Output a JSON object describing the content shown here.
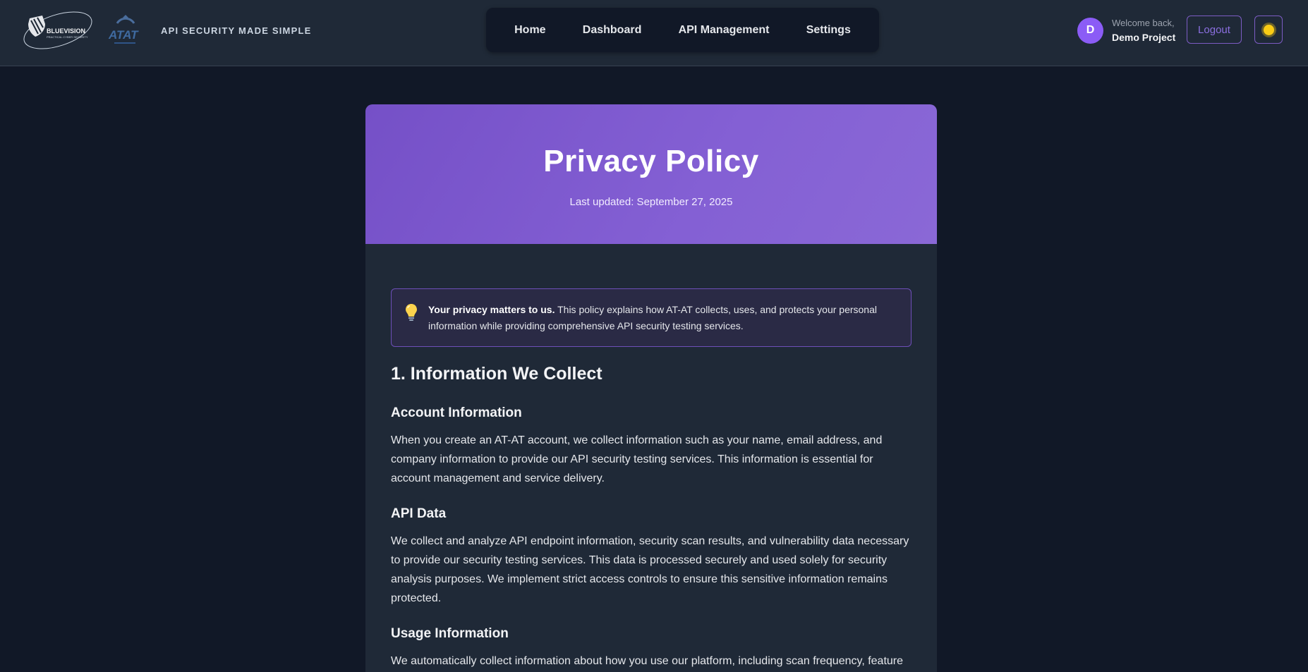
{
  "header": {
    "brand_text": "BLUEVISION",
    "brand_subtext": "PRACTICAL CYBER SECURITY",
    "atat_text": "ATAT",
    "tagline": "API SECURITY MADE SIMPLE",
    "nav": [
      "Home",
      "Dashboard",
      "API Management",
      "Settings"
    ],
    "avatar_initial": "D",
    "welcome": "Welcome back,",
    "project": "Demo Project",
    "logout": "Logout",
    "theme_icon": "sun-icon"
  },
  "page": {
    "title": "Privacy Policy",
    "updated": "Last updated: September 27, 2025",
    "notice_bold": "Your privacy matters to us.",
    "notice_text": " This policy explains how AT-AT collects, uses, and protects your personal information while providing comprehensive API security testing services.",
    "sections": [
      {
        "heading": "1. Information We Collect",
        "subs": [
          {
            "title": "Account Information",
            "text": "When you create an AT-AT account, we collect information such as your name, email address, and company information to provide our API security testing services. This information is essential for account management and service delivery."
          },
          {
            "title": "API Data",
            "text": "We collect and analyze API endpoint information, security scan results, and vulnerability data necessary to provide our security testing services. This data is processed securely and used solely for security analysis purposes. We implement strict access controls to ensure this sensitive information remains protected."
          },
          {
            "title": "Usage Information",
            "text": "We automatically collect information about how you use our platform, including scan frequency, feature"
          }
        ]
      }
    ]
  },
  "colors": {
    "background": "#111827",
    "header": "#1f2937",
    "accent": "#8b5cf6",
    "hero": "#7f5ad0"
  }
}
